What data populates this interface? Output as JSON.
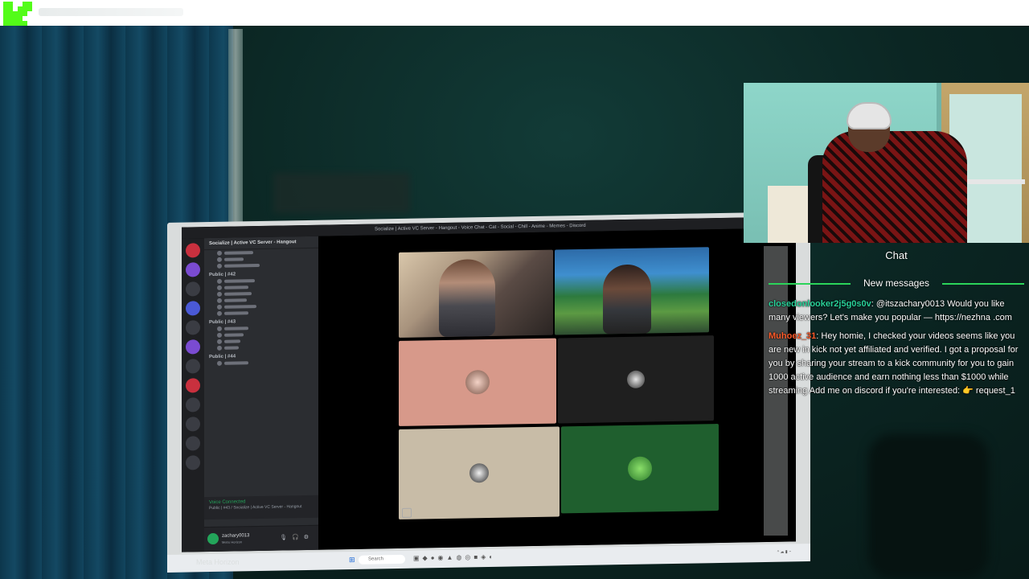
{
  "brand": {
    "logo_letter": "K",
    "logo_color": "#53fc18"
  },
  "monitor": {
    "window_title": "Socialize | Active VC Server - Hangout - Voice Chat - Cat - Social - Chill - Anime - Memes - Discord",
    "server_name": "Socialize | Active VC Server - Hangout",
    "categories": [
      "Public | #42",
      "Public | #43",
      "Public | #44"
    ],
    "voice_connected": "Voice Connected",
    "voice_sub": "Public | #43 / Socialize | Active VC Server - Hangout",
    "user_name": "zachary0013",
    "user_status": "Metro Horizon",
    "taskbar_search": "Search",
    "meta_label": "Meta Horizon"
  },
  "chat": {
    "title": "Chat",
    "new_messages_label": "New messages",
    "messages": [
      {
        "user": "closedonlooker2j5g0s0v",
        "text": "@itszachary0013 Would you like many viewers? Let's make you popular — https://nezhna .com"
      },
      {
        "user": "Muhoez_31",
        "text": "Hey homie, I checked your videos seems like you are new in kick not yet affiliated and verified. I got a proposal for you by sharing your stream to a kick community for you to gain 1000 active audience and earn nothing less than $1000 while streaming Add me on discord if you're interested: 👉 request_1"
      }
    ]
  },
  "colors": {
    "accent": "#53fc18",
    "chat_user1": "#29d29a",
    "chat_user2": "#ff5c2b",
    "divider": "#2bd45a"
  }
}
